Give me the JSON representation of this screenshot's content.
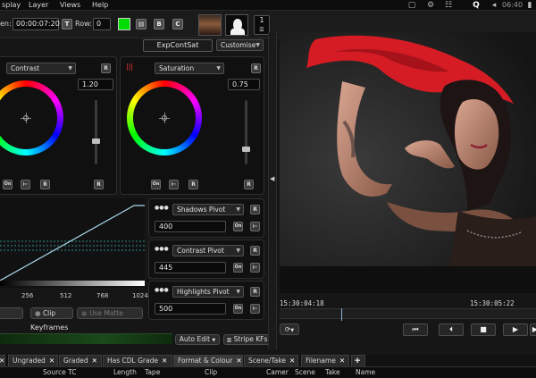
{
  "menubar": {
    "items": [
      "splay",
      "Layer",
      "Views",
      "Help"
    ],
    "clock": "06:40"
  },
  "toolbar": {
    "time_label": "en:",
    "time_value": "00:00:07:20",
    "row_label": "Row:",
    "row_value": "0",
    "swatch_color": "#00dd00",
    "num_value": "1",
    "preset_name": "ExpContSat",
    "customise_label": "Customise"
  },
  "left_wheel": {
    "mode": "Contrast",
    "value": "1.20",
    "on_label": "On"
  },
  "right_wheel": {
    "mode": "Saturation",
    "value": "0.75",
    "on_label": "On"
  },
  "curve": {
    "ticks": [
      "256",
      "512",
      "768",
      "1024"
    ]
  },
  "pivots": [
    {
      "label": "Shadows Pivot",
      "value": "400",
      "on_label": "On"
    },
    {
      "label": "Contrast Pivot",
      "value": "445",
      "on_label": "On"
    },
    {
      "label": "Highlights Pivot",
      "value": "500",
      "on_label": "On"
    }
  ],
  "bottom_left": {
    "clip_label": "Clip",
    "use_matte_label": "Use Matte",
    "keyframes_label": "Keyframes",
    "auto_edit_label": "Auto Edit",
    "stripe_kfs_label": "Stripe KFs"
  },
  "timeline": {
    "tc_start": "15:30:04:18",
    "tc_end": "15:30:05:22",
    "playhead_position": 0.24
  },
  "tabs": [
    {
      "label": "Ungraded"
    },
    {
      "label": "Graded"
    },
    {
      "label": "Has CDL Grade"
    },
    {
      "label": "Format & Colour"
    },
    {
      "label": "Scene/Take"
    },
    {
      "label": "Filename"
    }
  ],
  "columns": [
    "Source TC",
    "Length",
    "Tape",
    "Clip",
    "Camer",
    "Scene",
    "Take",
    "Name"
  ],
  "colors": {
    "accent_green": "#00dd00",
    "scarf_red": "#d51c24",
    "curve_line": "#a9d6ea"
  }
}
